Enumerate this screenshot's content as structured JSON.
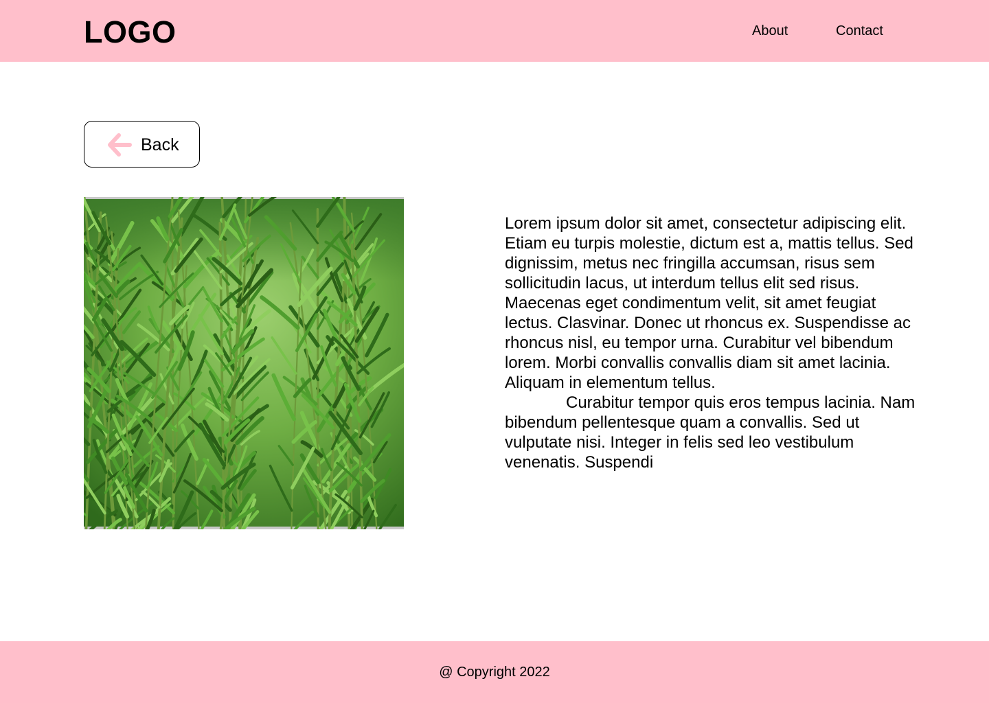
{
  "header": {
    "logo": "LOGO",
    "nav": {
      "about": "About",
      "contact": "Contact"
    }
  },
  "back_button": {
    "label": "Back",
    "icon": "arrow-left-icon",
    "icon_color": "#FFBFCB"
  },
  "content": {
    "image": "rosemary-plant-photo",
    "paragraphs": [
      "Lorem ipsum dolor sit amet, consectetur adipiscing elit. Etiam eu turpis molestie, dictum est a, mattis tellus. Sed dignissim, metus nec fringilla accumsan, risus sem sollicitudin lacus, ut interdum tellus elit sed risus. Maecenas eget condimentum velit, sit amet feugiat lectus. Clasvinar. Donec ut rhoncus ex. Suspendisse ac rhoncus nisl, eu tempor urna. Curabitur vel bibendum lorem. Morbi convallis convallis diam sit amet lacinia. Aliquam in elementum tellus.",
      "Curabitur tempor quis eros tempus lacinia. Nam bibendum pellentesque quam a convallis. Sed ut vulputate nisi. Integer in felis sed leo vestibulum venenatis. Suspendi"
    ]
  },
  "footer": {
    "copyright": "@ Copyright 2022"
  },
  "colors": {
    "brand_pink": "#FFBFCB",
    "text": "#000000",
    "background": "#FFFFFF"
  }
}
